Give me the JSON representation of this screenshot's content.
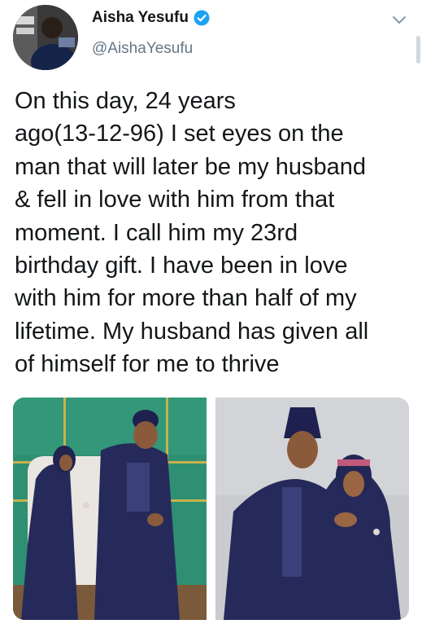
{
  "tweet": {
    "display_name": "Aisha Yesufu",
    "handle": "@AishaYesufu",
    "verified_icon": "verified-badge-icon",
    "menu_icon": "chevron-down-icon",
    "text_lines": [
      "On this day, 24 years",
      "ago(13-12-96) I set eyes on the",
      "man that will later be my husband",
      "& fell in love with him from that",
      "moment. I call him my 23rd",
      "birthday gift. I have been in love",
      "with him for more than half of my",
      "lifetime. My husband has given all",
      "of himself for me to thrive"
    ],
    "colors": {
      "text": "#14171a",
      "handle": "#657786",
      "verified": "#1da1f2",
      "photo1_wall": "#2f8f73",
      "outfit": "#262a5a"
    }
  }
}
